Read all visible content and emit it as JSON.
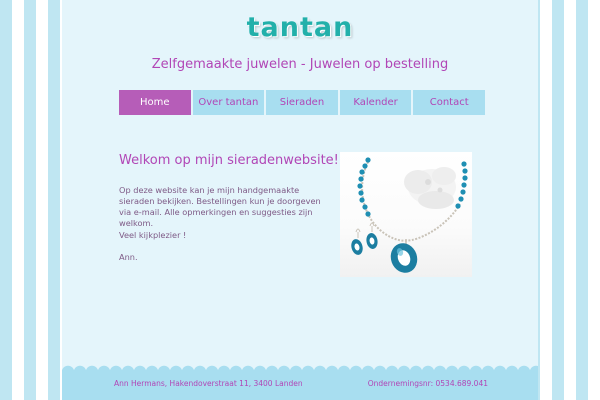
{
  "site": {
    "title": "tantan",
    "tagline": "Zelfgemaakte juwelen - Juwelen op bestelling"
  },
  "nav": {
    "items": [
      {
        "label": "Home",
        "active": true
      },
      {
        "label": "Over tantan",
        "active": false
      },
      {
        "label": "Sieraden",
        "active": false
      },
      {
        "label": "Kalender",
        "active": false
      },
      {
        "label": "Contact",
        "active": false
      }
    ]
  },
  "main": {
    "heading": "Welkom op mijn sieradenwebsite!",
    "paragraphs": [
      "Op deze website kan je mijn handgemaakte sieraden bekijken. Bestellingen kun je doorgeven via e-mail. Alle opmerkingen en suggesties zijn welkom.",
      "Veel kijkplezier !",
      "Ann."
    ]
  },
  "photo": {
    "subject": "turquoise beaded necklace with oval pendant and matching earrings"
  },
  "footer": {
    "address": "Ann Hermans, Hakendoverstraat 11, 3400 Landen",
    "company_number": "Ondernemingsnr: 0534.689.041"
  },
  "colors": {
    "logo": "#22b0aa",
    "accent": "#b146b6",
    "nav_bg": "#a8def0",
    "nav_active": "#b65db8",
    "page_bg": "#e4f5fb",
    "stripe": "#bfe6f2"
  }
}
